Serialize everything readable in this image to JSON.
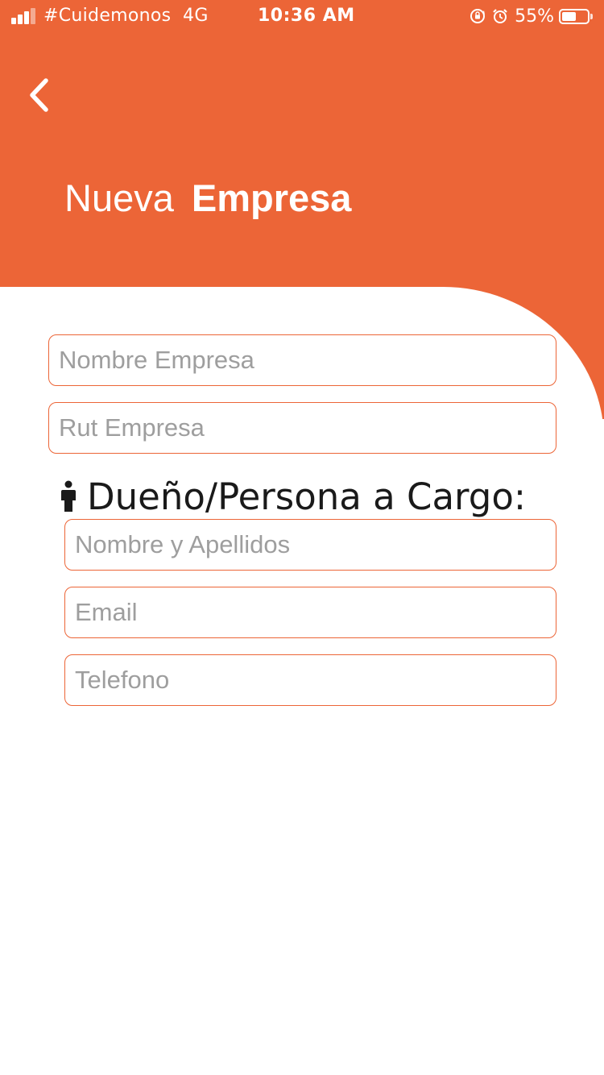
{
  "status_bar": {
    "carrier": "#Cuidemonos",
    "network": "4G",
    "time": "10:36 AM",
    "battery_percent": "55%",
    "battery_level": 0.55,
    "icons": [
      "signal-icon",
      "orientation-lock-icon",
      "alarm-icon",
      "battery-icon"
    ]
  },
  "header": {
    "back_icon": "chevron-left-icon",
    "title_regular": "Nueva",
    "title_bold": "Empresa"
  },
  "form": {
    "company_name_placeholder": "Nombre Empresa",
    "company_rut_placeholder": "Rut Empresa",
    "owner_section_label": "Dueño/Persona a Cargo:",
    "owner_section_icon": "person-icon",
    "owner_name_placeholder": "Nombre y Apellidos",
    "owner_email_placeholder": "Email",
    "owner_phone_placeholder": "Telefono"
  },
  "colors": {
    "accent": "#EC6537",
    "background": "#FFFFFF",
    "placeholder": "#9E9E9E",
    "label": "#1A1A1A"
  }
}
